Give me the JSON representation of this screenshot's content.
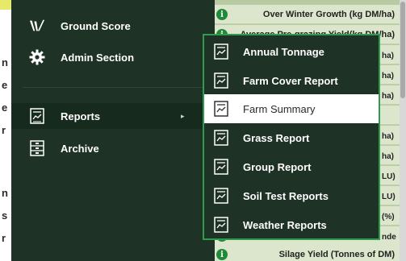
{
  "background": {
    "left_chunks": [
      "n",
      "e",
      "e",
      "r",
      "n",
      "s",
      "r"
    ],
    "rows": [
      {
        "label": "Over Winter Growth (kg DM/ha)"
      },
      {
        "label": "Average Pre-grazing Yield(kg DM/ha)"
      },
      {
        "label": ""
      },
      {
        "label": ""
      },
      {
        "label": ""
      },
      {
        "label": ""
      },
      {
        "label": ""
      },
      {
        "label": ""
      },
      {
        "label": ""
      },
      {
        "label": ""
      },
      {
        "label": ""
      },
      {
        "label": ""
      },
      {
        "label": "Silage Yield (Tonnes of DM)"
      }
    ],
    "peeks": [
      "ha)",
      "ha)",
      "ha)",
      "ha)",
      "ha)",
      "LU)",
      "LU)",
      "(%)",
      "nde"
    ]
  },
  "menu": {
    "items": [
      {
        "label": "Ground Score",
        "icon": "ground-score-logo-icon"
      },
      {
        "label": "Admin Section",
        "icon": "gear-icon"
      },
      {
        "label": "Reports",
        "icon": "report-icon",
        "arrow": "▸"
      },
      {
        "label": "Archive",
        "icon": "archive-icon"
      }
    ]
  },
  "submenu": {
    "items": [
      {
        "label": "Annual Tonnage"
      },
      {
        "label": "Farm Cover Report"
      },
      {
        "label": "Farm Summary",
        "active": true
      },
      {
        "label": "Grass Report"
      },
      {
        "label": "Group Report"
      },
      {
        "label": "Soil Test Reports"
      },
      {
        "label": "Weather Reports"
      }
    ]
  },
  "colors": {
    "menu_bg": "#1f3226",
    "submenu_border": "#2f9b4f",
    "info_icon": "#1f8a3a"
  }
}
